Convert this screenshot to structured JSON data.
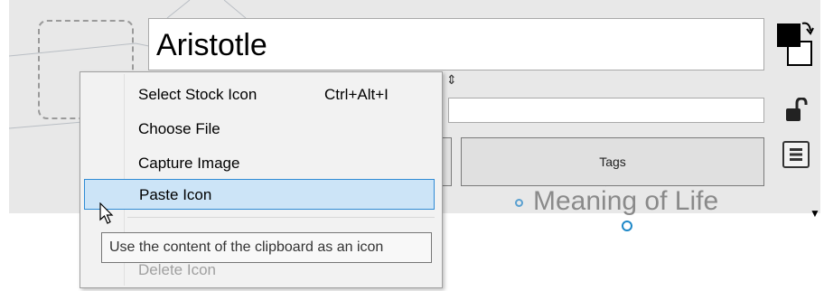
{
  "editor": {
    "name_value": "Aristotle",
    "tags_label": "Tags",
    "resize_glyph": "⇕",
    "colors": {
      "panel_bg": "#e8e8e8",
      "swatch_front": "#000000",
      "swatch_back": "#ffffff"
    },
    "icons": [
      "dashed-icon-slot",
      "swap-colors-icon",
      "unlock-icon",
      "hamburger-menu-icon",
      "dropdown-arrow-icon"
    ]
  },
  "canvas": {
    "topic_label": "Meaning of Life",
    "dot_colors": [
      "#5aa0d0",
      "#1e88c8"
    ]
  },
  "context_menu": {
    "items": [
      {
        "label": "Select Stock Icon",
        "shortcut": "Ctrl+Alt+I",
        "state": "normal"
      },
      {
        "label": "Choose File",
        "shortcut": "",
        "state": "normal"
      },
      {
        "label": "Capture Image",
        "shortcut": "",
        "state": "normal"
      },
      {
        "label": "Paste Icon",
        "shortcut": "",
        "state": "highlighted"
      },
      {
        "label": "Delete Icon",
        "shortcut": "",
        "state": "disabled"
      }
    ],
    "highlight_color": "#cce4f7",
    "highlight_border": "#2f8bd5"
  },
  "tooltip": {
    "text": "Use the content of the clipboard as an icon"
  }
}
